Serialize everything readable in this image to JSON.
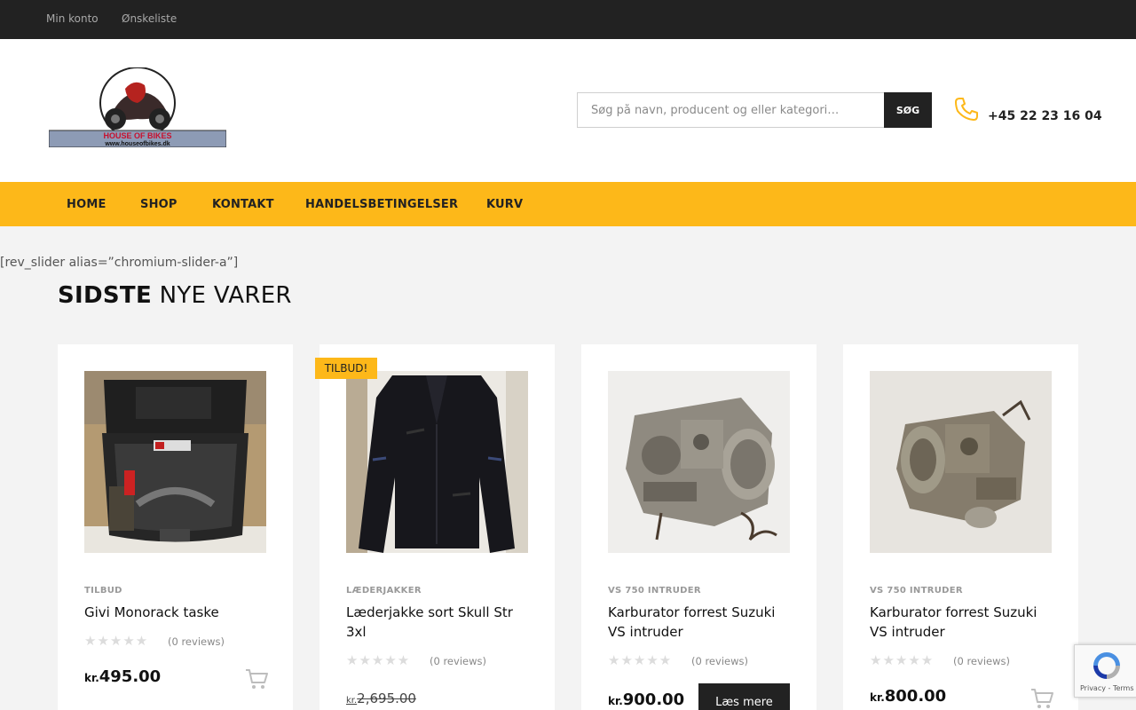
{
  "topbar": {
    "links": [
      "Min konto",
      "Ønskeliste"
    ]
  },
  "header": {
    "logo_text": "HOUSE OF BIKES",
    "logo_url_text": "www.houseofbikes.dk",
    "search": {
      "placeholder": "Søg på navn, producent og eller kategori…",
      "button_label": "SØG"
    },
    "phone": "+45 22 23 16 04"
  },
  "nav": {
    "items": [
      "HOME",
      "SHOP",
      "KONTAKT",
      "HANDELSBETINGELSER",
      "KURV"
    ]
  },
  "main": {
    "shortcode_text": "[rev_slider alias=”chromium-slider-a”]",
    "section_title_bold": "SIDSTE",
    "section_title_light": "NYE VARER"
  },
  "products": [
    {
      "category": "TILBUD",
      "name": "Givi Monorack taske",
      "reviews": "(0 reviews)",
      "currency": "kr.",
      "price": "495.00",
      "action": "cart"
    },
    {
      "badge": "TILBUD!",
      "category": "LÆDERJAKKER",
      "name": "Læderjakke sort Skull Str 3xl",
      "reviews": "(0 reviews)",
      "currency": "kr.",
      "old_price": "2,695.00"
    },
    {
      "category": "VS 750 INTRUDER",
      "name": "Karburator forrest Suzuki VS intruder",
      "reviews": "(0 reviews)",
      "currency": "kr.",
      "price": "900.00",
      "action_label": "Læs mere"
    },
    {
      "category": "VS 750 INTRUDER",
      "name": "Karburator forrest Suzuki VS intruder",
      "reviews": "(0 reviews)",
      "currency": "kr.",
      "price": "800.00",
      "action": "cart"
    }
  ],
  "recaptcha": {
    "text": "Privacy - Terms"
  },
  "colors": {
    "accent": "#fdb819",
    "topbar": "#222222",
    "background": "#f3f3f3"
  }
}
